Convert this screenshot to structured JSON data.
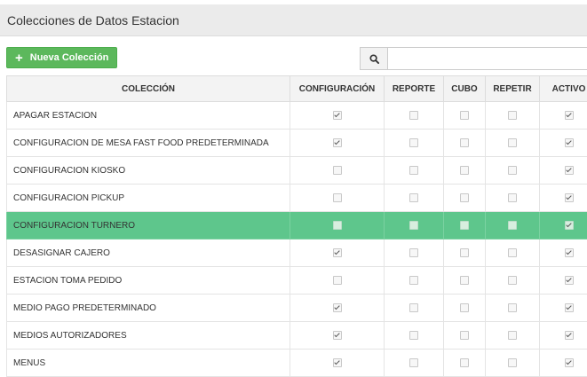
{
  "header": {
    "title": "Colecciones de Datos Estacion"
  },
  "toolbar": {
    "new_label": "Nueva Colección",
    "search_value": "",
    "search_placeholder": ""
  },
  "table": {
    "columns": [
      "COLECCIÓN",
      "CONFIGURACIÓN",
      "REPORTE",
      "CUBO",
      "REPETIR",
      "ACTIVO"
    ],
    "rows": [
      {
        "name": "APAGAR ESTACION",
        "config": true,
        "reporte": false,
        "cubo": false,
        "repetir": false,
        "activo": true,
        "selected": false
      },
      {
        "name": "CONFIGURACION DE MESA FAST FOOD PREDETERMINADA",
        "config": true,
        "reporte": false,
        "cubo": false,
        "repetir": false,
        "activo": true,
        "selected": false
      },
      {
        "name": "CONFIGURACION KIOSKO",
        "config": false,
        "reporte": false,
        "cubo": false,
        "repetir": false,
        "activo": true,
        "selected": false
      },
      {
        "name": "CONFIGURACION PICKUP",
        "config": false,
        "reporte": false,
        "cubo": false,
        "repetir": false,
        "activo": true,
        "selected": false
      },
      {
        "name": "CONFIGURACION TURNERO",
        "config": false,
        "reporte": false,
        "cubo": false,
        "repetir": false,
        "activo": true,
        "selected": true
      },
      {
        "name": "DESASIGNAR CAJERO",
        "config": true,
        "reporte": false,
        "cubo": false,
        "repetir": false,
        "activo": true,
        "selected": false
      },
      {
        "name": "ESTACION TOMA PEDIDO",
        "config": false,
        "reporte": false,
        "cubo": false,
        "repetir": false,
        "activo": true,
        "selected": false
      },
      {
        "name": "MEDIO PAGO PREDETERMINADO",
        "config": true,
        "reporte": false,
        "cubo": false,
        "repetir": false,
        "activo": true,
        "selected": false
      },
      {
        "name": "MEDIOS AUTORIZADORES",
        "config": true,
        "reporte": false,
        "cubo": false,
        "repetir": false,
        "activo": true,
        "selected": false
      },
      {
        "name": "MENUS",
        "config": true,
        "reporte": false,
        "cubo": false,
        "repetir": false,
        "activo": true,
        "selected": false
      }
    ]
  },
  "colors": {
    "accent": "#5cb85c",
    "selected_row": "#5ec68c",
    "header_bg": "#ebebeb"
  },
  "icons": {
    "new": "plus-icon",
    "search": "search-icon"
  }
}
